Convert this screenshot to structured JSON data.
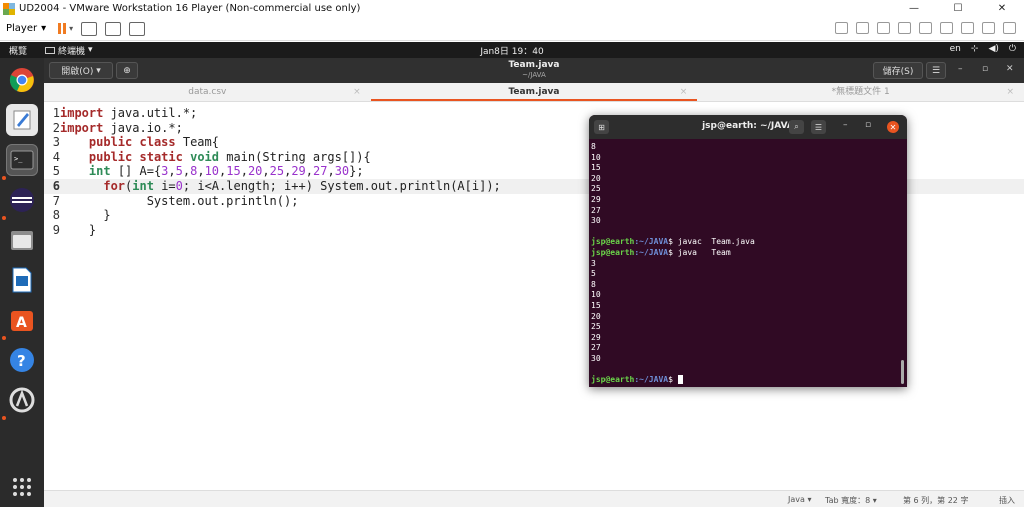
{
  "vmware": {
    "window_title": "UD2004 - VMware Workstation 16 Player (Non-commercial use only)",
    "minimize": "—",
    "maximize": "☐",
    "close": "✕",
    "player_menu": "Player",
    "dropdown_arrow": "▾"
  },
  "ubuntu_topbar": {
    "activities": "概覽",
    "app_menu": "終端機",
    "clock": "Jan8日 19：40",
    "input_method": "en",
    "tray_icons": [
      "network-icon",
      "volume-icon",
      "power-icon"
    ]
  },
  "dock": {
    "apps": [
      "chrome-icon",
      "text-editor-icon",
      "terminal-icon",
      "eclipse-icon",
      "files-icon",
      "writer-icon",
      "software-center-icon",
      "help-icon",
      "updater-icon",
      "show-apps-icon"
    ]
  },
  "gedit": {
    "open_label": "開啟(O)",
    "title": "Team.java",
    "subtitle": "~/JAVA",
    "save_label": "儲存(S)",
    "tabs": [
      {
        "label": "data.csv",
        "active": false
      },
      {
        "label": "Team.java",
        "active": true
      },
      {
        "label": "*無標題文件 1",
        "active": false
      }
    ],
    "code": [
      {
        "n": "1",
        "parts": [
          [
            "kw",
            "import"
          ],
          [
            "txt",
            " java.util.*;"
          ]
        ]
      },
      {
        "n": "2",
        "parts": [
          [
            "kw",
            "import"
          ],
          [
            "txt",
            " java.io.*;"
          ]
        ]
      },
      {
        "n": "3",
        "parts": [
          [
            "txt",
            "    "
          ],
          [
            "kw",
            "public"
          ],
          [
            "txt",
            " "
          ],
          [
            "kw",
            "class"
          ],
          [
            "txt",
            " Team{"
          ]
        ]
      },
      {
        "n": "4",
        "parts": [
          [
            "txt",
            "    "
          ],
          [
            "kw",
            "public"
          ],
          [
            "txt",
            " "
          ],
          [
            "kw",
            "static"
          ],
          [
            "txt",
            " "
          ],
          [
            "ty",
            "void"
          ],
          [
            "txt",
            " main(String args[]){"
          ]
        ]
      },
      {
        "n": "5",
        "parts": [
          [
            "txt",
            "    "
          ],
          [
            "ty",
            "int"
          ],
          [
            "txt",
            " [] A={"
          ],
          [
            "num",
            "3"
          ],
          [
            "txt",
            ","
          ],
          [
            "num",
            "5"
          ],
          [
            "txt",
            ","
          ],
          [
            "num",
            "8"
          ],
          [
            "txt",
            ","
          ],
          [
            "num",
            "10"
          ],
          [
            "txt",
            ","
          ],
          [
            "num",
            "15"
          ],
          [
            "txt",
            ","
          ],
          [
            "num",
            "20"
          ],
          [
            "txt",
            ","
          ],
          [
            "num",
            "25"
          ],
          [
            "txt",
            ","
          ],
          [
            "num",
            "29"
          ],
          [
            "txt",
            ","
          ],
          [
            "num",
            "27"
          ],
          [
            "txt",
            ","
          ],
          [
            "num",
            "30"
          ],
          [
            "txt",
            "};"
          ]
        ]
      },
      {
        "n": "6",
        "parts": [
          [
            "txt",
            "      "
          ],
          [
            "kw",
            "for"
          ],
          [
            "txt",
            "("
          ],
          [
            "ty",
            "int"
          ],
          [
            "txt",
            " i="
          ],
          [
            "num",
            "0"
          ],
          [
            "txt",
            "; i<A.length; i++) System.out.println(A[i]);"
          ]
        ]
      },
      {
        "n": "7",
        "parts": [
          [
            "txt",
            "            System.out.println();"
          ]
        ]
      },
      {
        "n": "8",
        "parts": [
          [
            "txt",
            "      }"
          ]
        ]
      },
      {
        "n": "9",
        "parts": [
          [
            "txt",
            "    }"
          ]
        ]
      }
    ],
    "current_line": 6,
    "status": {
      "language": "Java ▾",
      "tab_width": "Tab 寬度：8 ▾",
      "position": "第 6 列，第 22 字",
      "mode": "插入"
    }
  },
  "terminal": {
    "title": "jsp@earth: ~/JAVA",
    "lines": [
      {
        "t": "8"
      },
      {
        "t": "10"
      },
      {
        "t": "15"
      },
      {
        "t": "20"
      },
      {
        "t": "25"
      },
      {
        "t": "29"
      },
      {
        "t": "27"
      },
      {
        "t": "30"
      },
      {
        "t": ""
      },
      {
        "prompt": true,
        "user": "jsp@earth",
        "path": ":~/JAVA",
        "cmd": "$ javac  Team.java"
      },
      {
        "prompt": true,
        "user": "jsp@earth",
        "path": ":~/JAVA",
        "cmd": "$ java   Team"
      },
      {
        "t": "3"
      },
      {
        "t": "5"
      },
      {
        "t": "8"
      },
      {
        "t": "10"
      },
      {
        "t": "15"
      },
      {
        "t": "20"
      },
      {
        "t": "25"
      },
      {
        "t": "29"
      },
      {
        "t": "27"
      },
      {
        "t": "30"
      },
      {
        "t": ""
      },
      {
        "prompt": true,
        "user": "jsp@earth",
        "path": ":~/JAVA",
        "cmd": "$ ",
        "cursor": true
      }
    ]
  },
  "colors": {
    "ubuntu_orange": "#e95420",
    "terminal_bg": "#300a24",
    "prompt_user": "#6ad449",
    "prompt_path": "#6f8fd8"
  }
}
